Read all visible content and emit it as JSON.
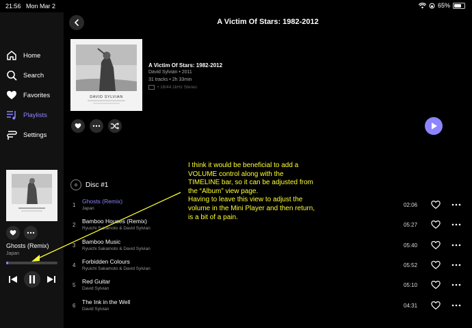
{
  "status": {
    "time": "21:56",
    "date": "Mon Mar 2",
    "battery": "65%"
  },
  "sidebar": {
    "items": [
      {
        "label": "Home",
        "icon": "home-icon"
      },
      {
        "label": "Search",
        "icon": "search-icon"
      },
      {
        "label": "Favorites",
        "icon": "heart-icon"
      },
      {
        "label": "Playlists",
        "icon": "playlist-icon"
      },
      {
        "label": "Settings",
        "icon": "settings-icon"
      }
    ]
  },
  "mini_player": {
    "title": "Ghosts (Remix)",
    "artist": "Japan",
    "progress": 0.04
  },
  "album": {
    "page_title": "A Victim Of Stars: 1982-2012",
    "title": "A Victim Of Stars: 1982-2012",
    "artist_year": "David Sylvian • 2011",
    "tracks_duration": "31 tracks • 2h 33min",
    "quality": "• 16/44.1kHz Stereo",
    "cover_text": "DAVID SYLVIAN"
  },
  "disc": {
    "label": "Disc #1"
  },
  "tracks": [
    {
      "num": "1",
      "title": "Ghosts (Remix)",
      "artist": "Japan",
      "duration": "02:06",
      "playing": true
    },
    {
      "num": "2",
      "title": "Bamboo Houses (Remix)",
      "artist": "Ryuichi Sakamoto & David Sylvian",
      "duration": "05:27"
    },
    {
      "num": "3",
      "title": "Bamboo Music",
      "artist": "Ryuichi Sakamoto & David Sylvian",
      "duration": "05:40"
    },
    {
      "num": "4",
      "title": "Forbidden Colours",
      "artist": "Ryuichi Sakamoto & David Sylvian",
      "duration": "05:52"
    },
    {
      "num": "5",
      "title": "Red Guitar",
      "artist": "David Sylvian",
      "duration": "05:10"
    },
    {
      "num": "6",
      "title": "The Ink in the Well",
      "artist": "David Sylvian",
      "duration": "04:31"
    }
  ],
  "annotation": {
    "lines": [
      "I think it would be beneficial to add a",
      "VOLUME control along with the",
      "TIMELINE bar, so it can be adjusted from",
      "the “Album” view page.",
      "Having to leave this view to adjust the",
      "volume in the Mini Player and then return,",
      "is a bit of a pain."
    ]
  },
  "colors": {
    "accent": "#8d84ff",
    "annotation": "#ffff33",
    "sidebar_bg": "#121212"
  }
}
